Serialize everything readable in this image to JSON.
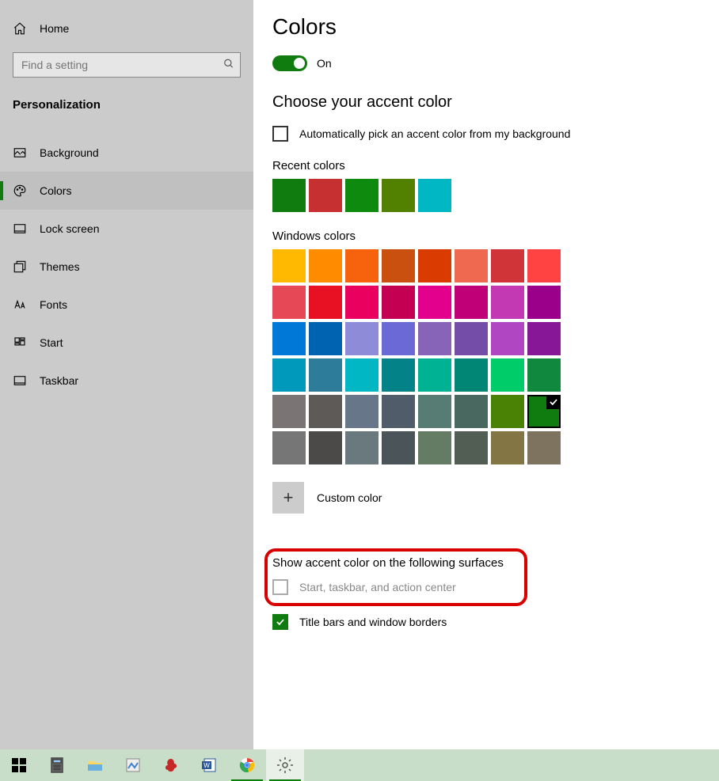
{
  "sidebar": {
    "home": "Home",
    "search_placeholder": "Find a setting",
    "section": "Personalization",
    "items": [
      {
        "label": "Background"
      },
      {
        "label": "Colors"
      },
      {
        "label": "Lock screen"
      },
      {
        "label": "Themes"
      },
      {
        "label": "Fonts"
      },
      {
        "label": "Start"
      },
      {
        "label": "Taskbar"
      }
    ]
  },
  "main": {
    "title": "Colors",
    "toggle_label": "On",
    "subhead": "Choose your accent color",
    "auto_pick_label": "Automatically pick an accent color from my background",
    "recent_label": "Recent colors",
    "recent_colors": [
      "#107c10",
      "#c73030",
      "#0e8a0e",
      "#528000",
      "#00b7c3"
    ],
    "windows_label": "Windows colors",
    "windows_colors": [
      "#ffb900",
      "#ff8c00",
      "#f7630c",
      "#ca5010",
      "#da3b01",
      "#ef6950",
      "#d13438",
      "#ff4343",
      "#e74856",
      "#e81123",
      "#ea005e",
      "#c30052",
      "#e3008c",
      "#bf0077",
      "#c239b3",
      "#9a0089",
      "#0078d7",
      "#0063b1",
      "#8e8cd8",
      "#6b69d6",
      "#8764b8",
      "#744da9",
      "#b146c2",
      "#881798",
      "#0099bc",
      "#2d7d9a",
      "#00b7c3",
      "#038387",
      "#00b294",
      "#018574",
      "#00cc6a",
      "#10893e",
      "#7a7574",
      "#5d5a58",
      "#68768a",
      "#515c6b",
      "#567c73",
      "#486860",
      "#498205",
      "#107c10",
      "#767676",
      "#4c4a48",
      "#69797e",
      "#4a5459",
      "#647c64",
      "#525e54",
      "#847545",
      "#7e735f"
    ],
    "selected_index": 39,
    "custom_label": "Custom color",
    "surfaces_header": "Show accent color on the following surfaces",
    "surface_start": "Start, taskbar, and action center",
    "surface_title": "Title bars and window borders"
  }
}
